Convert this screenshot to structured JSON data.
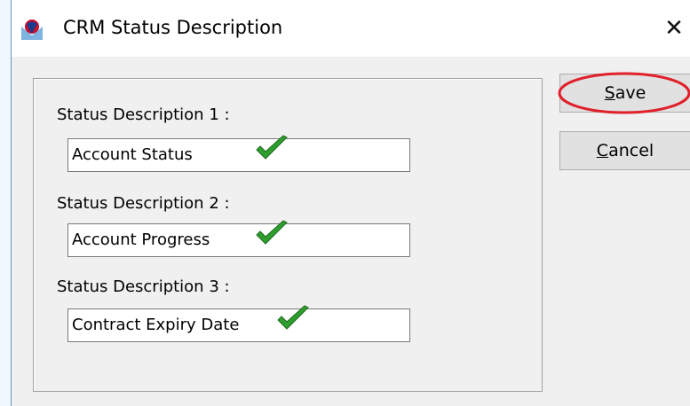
{
  "window": {
    "title": "CRM Status Description",
    "close_glyph": "✕",
    "icon": "app-globe-icon"
  },
  "form": {
    "fields": [
      {
        "label": "Status Description 1 :",
        "value": "Account Status"
      },
      {
        "label": "Status Description 2 :",
        "value": "Account Progress"
      },
      {
        "label": "Status Description 3 :",
        "value": "Contract Expiry Date"
      }
    ]
  },
  "buttons": {
    "save": {
      "accel": "S",
      "rest": "ave"
    },
    "cancel": {
      "accel": "C",
      "rest": "ancel"
    }
  },
  "colors": {
    "check_green": "#2e9e2e",
    "highlight_red": "#e0202a"
  }
}
